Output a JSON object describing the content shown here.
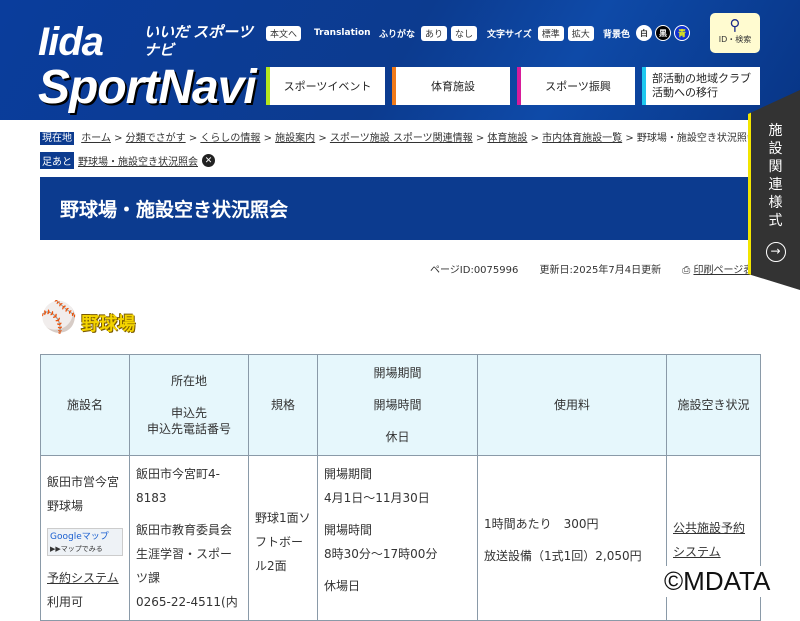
{
  "header": {
    "logo_line1": "Iida",
    "logo_sub": "いいだ スポーツナビ",
    "logo_line2": "SportNavi",
    "skip": "本文へ",
    "translation": "Translation",
    "furigana_label": "ふりがな",
    "furigana_on": "あり",
    "furigana_off": "なし",
    "fontsize_label": "文字サイズ",
    "fontsize_normal": "標準",
    "fontsize_large": "拡大",
    "bg_label": "背景色",
    "bg_white": "白",
    "bg_black": "黒",
    "bg_blue": "青",
    "search_label": "ID・検索",
    "nav": [
      {
        "label": "スポーツイベント",
        "color": "#b5e61d"
      },
      {
        "label": "体育施設",
        "color": "#f07a1a"
      },
      {
        "label": "スポーツ振興",
        "color": "#d81b9a"
      },
      {
        "label": "部活動の地域クラブ活動への移行",
        "color": "#1ec8f0"
      }
    ]
  },
  "breadcrumb": {
    "tag": "現在地",
    "items": [
      "ホーム",
      "分類でさがす",
      "くらしの情報",
      "施設案内",
      "スポーツ施設 スポーツ関連情報",
      "体育施設",
      "市内体育施設一覧"
    ],
    "current": "野球場・施設空き状況照会"
  },
  "footprint": {
    "tag": "足あと",
    "item": "野球場・施設空き状況照会"
  },
  "page_title": "野球場・施設空き状況照会",
  "meta": {
    "page_id": "ページID:0075996",
    "updated": "更新日:2025年7月4日更新",
    "print": "印刷ページ表示"
  },
  "side_tab": "施設関連様式",
  "section_title": "野球場",
  "table": {
    "headers": [
      "施設名",
      "所在地\n\n申込先\n申込先電話番号",
      "規格",
      "開場期間\n\n開場時間\n\n休日",
      "使用料",
      "施設空き状況"
    ],
    "row": {
      "name": "飯田市営今宮野球場",
      "map_label": "Googleマップ",
      "map_sub": "▶▶マップでみる",
      "reserve_link": "予約システム",
      "reserve_note": "利用可",
      "address": "飯田市今宮町4-8183",
      "applicant": "飯田市教育委員会生涯学習・スポーツ課",
      "phone": "0265-22-4511(内",
      "spec": "野球1面ソフトボール2面",
      "period_label": "開場期間",
      "period": "4月1日～11月30日",
      "hours_label": "開場時間",
      "hours": "8時30分～17時00分",
      "holiday_label": "休場日",
      "fee1": "1時間あたり　300円",
      "fee2": "放送設備（1式1回）2,050円",
      "availability": "公共施設予約システム"
    }
  },
  "watermark": "©MDATA"
}
